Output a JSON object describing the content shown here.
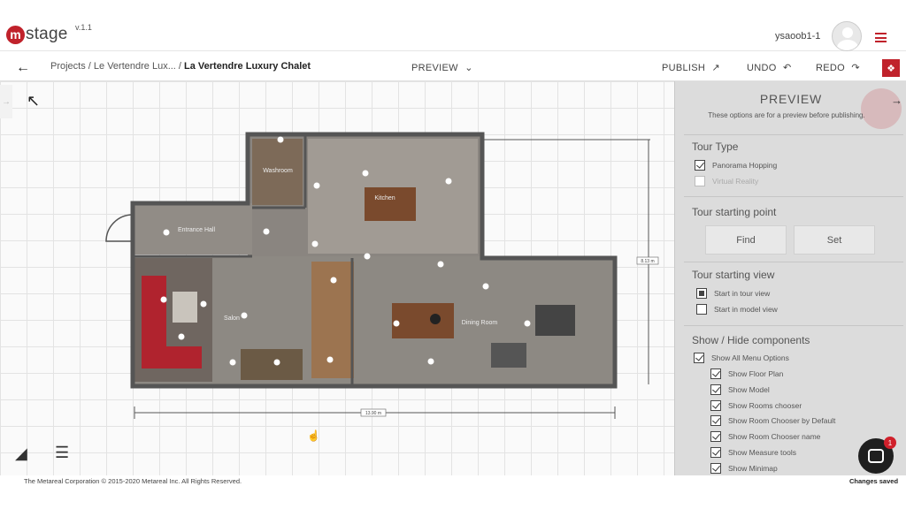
{
  "app": {
    "logo_letter": "m",
    "name": "stage",
    "version": "v.1.1"
  },
  "user": {
    "name": "ysaoob1-1"
  },
  "toolbar": {
    "breadcrumb_path": "Projects / Le Vertendre Lux... /",
    "current_project": "La Vertendre Luxury Chalet",
    "preview_label": "PREVIEW",
    "publish_label": "PUBLISH",
    "undo_label": "UNDO",
    "redo_label": "REDO"
  },
  "floorplan": {
    "rooms": [
      "Washroom",
      "Kitchen",
      "Entrance Hall",
      "Salon",
      "Dining Room"
    ],
    "dimension_labels": [
      "8.13 m",
      "13.90 m"
    ]
  },
  "panel": {
    "title": "PREVIEW",
    "subtitle": "These options are for a preview before publishing.",
    "tour_type": {
      "title": "Tour Type",
      "options": [
        {
          "label": "Panorama Hopping",
          "checked": true,
          "disabled": false
        },
        {
          "label": "Virtual Reality",
          "checked": false,
          "disabled": true
        }
      ]
    },
    "starting_point": {
      "title": "Tour starting point",
      "find_label": "Find",
      "set_label": "Set"
    },
    "starting_view": {
      "title": "Tour starting view",
      "options": [
        {
          "label": "Start in tour view",
          "selected": true
        },
        {
          "label": "Start in model view",
          "selected": false
        }
      ]
    },
    "components": {
      "title": "Show / Hide components",
      "all_label": "Show All Menu Options",
      "items": [
        "Show Floor Plan",
        "Show Model",
        "Show Rooms chooser",
        "Show Room Chooser by Default",
        "Show Room Chooser name",
        "Show Measure tools",
        "Show Minimap"
      ]
    }
  },
  "footer": {
    "copyright": "The Metareal Corporation © 2015-2020 Metareal Inc. All Rights Reserved.",
    "status": "Changes saved"
  },
  "chat": {
    "badge": "1"
  },
  "colors": {
    "brand": "#c0222b",
    "panel_bg": "#dcdcdc"
  }
}
